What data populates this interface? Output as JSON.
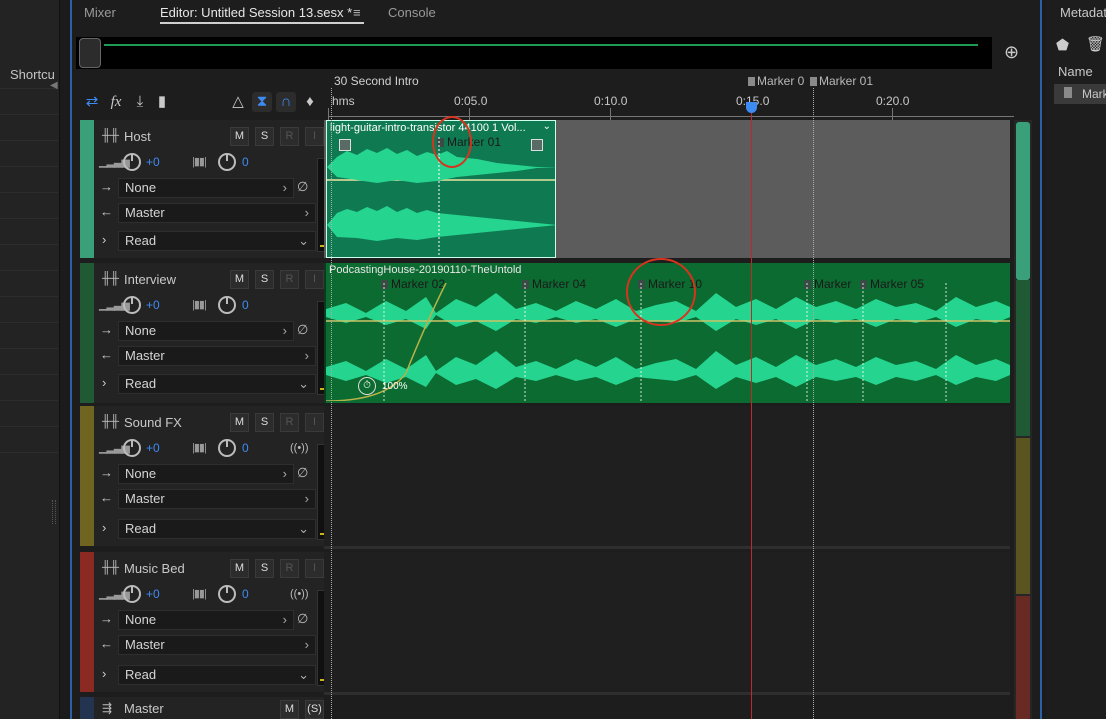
{
  "tabs": {
    "mixer": "Mixer",
    "editor": "Editor: Untitled Session 13.sesx *",
    "menu": "≡",
    "console": "Console"
  },
  "left_panel": {
    "title": "Shortcu"
  },
  "right_panel": {
    "title": "Metadat",
    "name_header": "Name",
    "row": "Mark"
  },
  "ruler": {
    "range_label": "30 Second Intro",
    "labels": [
      "hms",
      "0:05.0",
      "0:10.0",
      "0:15.0",
      "0:20.0"
    ],
    "markers": [
      "Marker 0",
      "Marker 01"
    ]
  },
  "tracks": [
    {
      "name": "Host",
      "color": "#3aa07a",
      "pan": "+0",
      "vol": "0",
      "input": "None",
      "output": "Master",
      "automation": "Read"
    },
    {
      "name": "Interview",
      "color": "#1f5a34",
      "pan": "+0",
      "vol": "0",
      "input": "None",
      "output": "Master",
      "automation": "Read"
    },
    {
      "name": "Sound FX",
      "color": "#6f6420",
      "pan": "+0",
      "vol": "0",
      "input": "None",
      "output": "Master",
      "automation": "Read"
    },
    {
      "name": "Music Bed",
      "color": "#8a2a22",
      "pan": "+0",
      "vol": "0",
      "input": "None",
      "output": "Master",
      "automation": "Read"
    }
  ],
  "master": {
    "name": "Master",
    "m": "M",
    "s": "(S)"
  },
  "buttons": {
    "m": "M",
    "s": "S",
    "r": "R",
    "i": "I"
  },
  "clips": {
    "host": {
      "title": "light-guitar-intro-transistor 44100 1 Vol...",
      "marker": "Marker 01"
    },
    "interview": {
      "title": "PodcastingHouse-20190110-TheUntold",
      "markers": [
        "Marker 02",
        "Marker 04",
        "Marker 10",
        "Marker",
        "Marker 05"
      ],
      "stretch": "100%"
    }
  }
}
